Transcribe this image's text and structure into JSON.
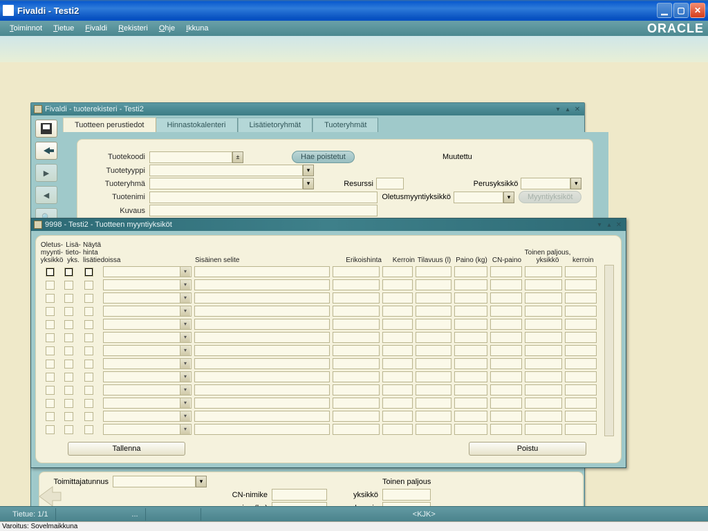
{
  "window": {
    "title": "Fivaldi - Testi2"
  },
  "menu": {
    "items": [
      "Toiminnot",
      "Tietue",
      "Fivaldi",
      "Rekisteri",
      "Ohje",
      "Ikkuna"
    ],
    "brand": "ORACLE"
  },
  "inner": {
    "title": "Fivaldi - tuoterekisteri - Testi2",
    "tabs": [
      "Tuotteen perustiedot",
      "Hinnastokalenteri",
      "Lisätietoryhmät",
      "Tuoteryhmät"
    ],
    "labels": {
      "tuotekoodi": "Tuotekoodi",
      "tuotetyyppi": "Tuotetyyppi",
      "tuoteryhma": "Tuoteryhmä",
      "tuotenimi": "Tuotenimi",
      "kuvaus": "Kuvaus",
      "muutettu": "Muutettu",
      "resurssi": "Resurssi",
      "perusyksikko": "Perusyksikkö",
      "oletusmyyntiyksikko": "Oletusmyyntiyksikkö",
      "hae_poistetut": "Hae poistetut",
      "myyntiyksikot": "Myyntiyksiköt",
      "toimittajatunnus": "Toimittajatunnus",
      "cn_nimike": "CN-nimike",
      "paino_kg": "paino (kg)",
      "toinen_paljous": "Toinen paljous",
      "yksikko": "yksikkö",
      "kerroin": "kerroin"
    }
  },
  "modal": {
    "title": "9998 - Testi2 - Tuotteen  myyntiyksiköt",
    "headers": {
      "oletus": "Oletus-\nmyynti-\nyksikkö",
      "lisa": "Lisä-\ntieto-\nyks.",
      "nayta": "Näytä\nhinta\nlisätiedoissa",
      "sisainen": "Sisäinen selite",
      "erikois": "Erikoishinta",
      "kerroin": "Kerroin",
      "tilavuus": "Tilavuus (l)",
      "paino": "Paino (kg)",
      "cnpaino": "CN-paino",
      "toinen_yks": "Toinen paljous,\nyksikkö",
      "toinen_ker": "kerroin"
    },
    "tallenna": "Tallenna",
    "poistu": "Poistu"
  },
  "status": {
    "tietue": "Tietue: 1/1",
    "dots": "...",
    "center": "<KJK>"
  },
  "footer": "Varoitus: Sovelmaikkuna"
}
